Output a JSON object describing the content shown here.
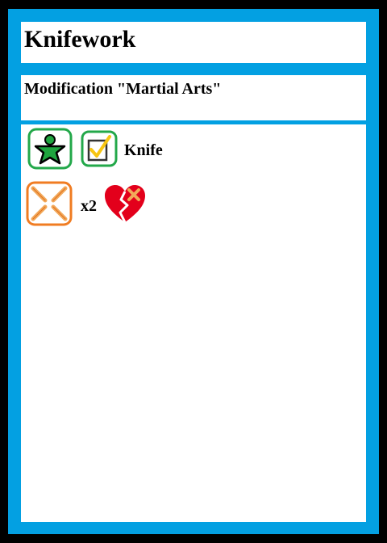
{
  "card": {
    "title": "Knifework",
    "subtitle": "Modification \"Martial Arts\"",
    "requirements": {
      "icons": [
        "person-icon",
        "checkbox-check-icon"
      ],
      "weapon_label": "Knife"
    },
    "effect": {
      "icons": [
        "crosshair-icon",
        "broken-heart-icon"
      ],
      "multiplier": "x2"
    }
  },
  "colors": {
    "border": "#03a0e2",
    "green_frame": "#23a84a",
    "orange_frame": "#f07c22",
    "heart": "#e3001b",
    "check": "#f7c512",
    "x_mark": "#f2a95a"
  }
}
